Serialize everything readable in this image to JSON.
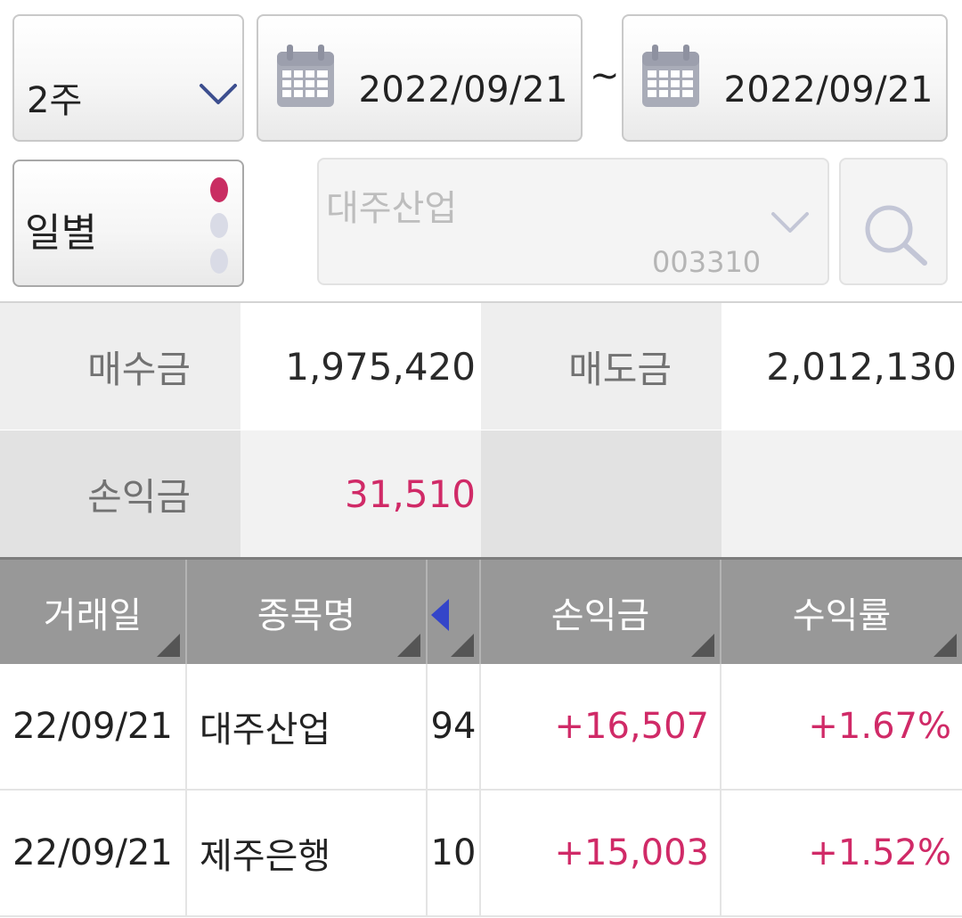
{
  "filters": {
    "period": "2주",
    "date_from": "2022/09/21",
    "date_separator": "~",
    "date_to": "2022/09/21",
    "mode": "일별",
    "stock_name": "대주산업",
    "stock_code": "003310"
  },
  "summary": {
    "buy_label": "매수금",
    "buy_value": "1,975,420",
    "sell_label": "매도금",
    "sell_value": "2,012,130",
    "profit_label": "손익금",
    "profit_value": "31,510"
  },
  "table": {
    "headers": [
      "거래일",
      "종목명",
      "손익금",
      "수익률"
    ],
    "rows": [
      {
        "date": "22/09/21",
        "name": "대주산업",
        "qty": "94",
        "profit": "+16,507",
        "rate": "+1.67%"
      },
      {
        "date": "22/09/21",
        "name": "제주은행",
        "qty": "10",
        "profit": "+15,003",
        "rate": "+1.52%"
      }
    ]
  },
  "colors": {
    "accent_pink": "#d02a67",
    "nav_arrow": "#3445c9",
    "header_bg": "#989898"
  },
  "icons": {
    "period_dropdown": "chevron-down-icon",
    "date": "calendar-icon",
    "stock_dropdown": "chevron-down-icon",
    "search": "search-icon",
    "column_nav": "triangle-left-icon"
  }
}
